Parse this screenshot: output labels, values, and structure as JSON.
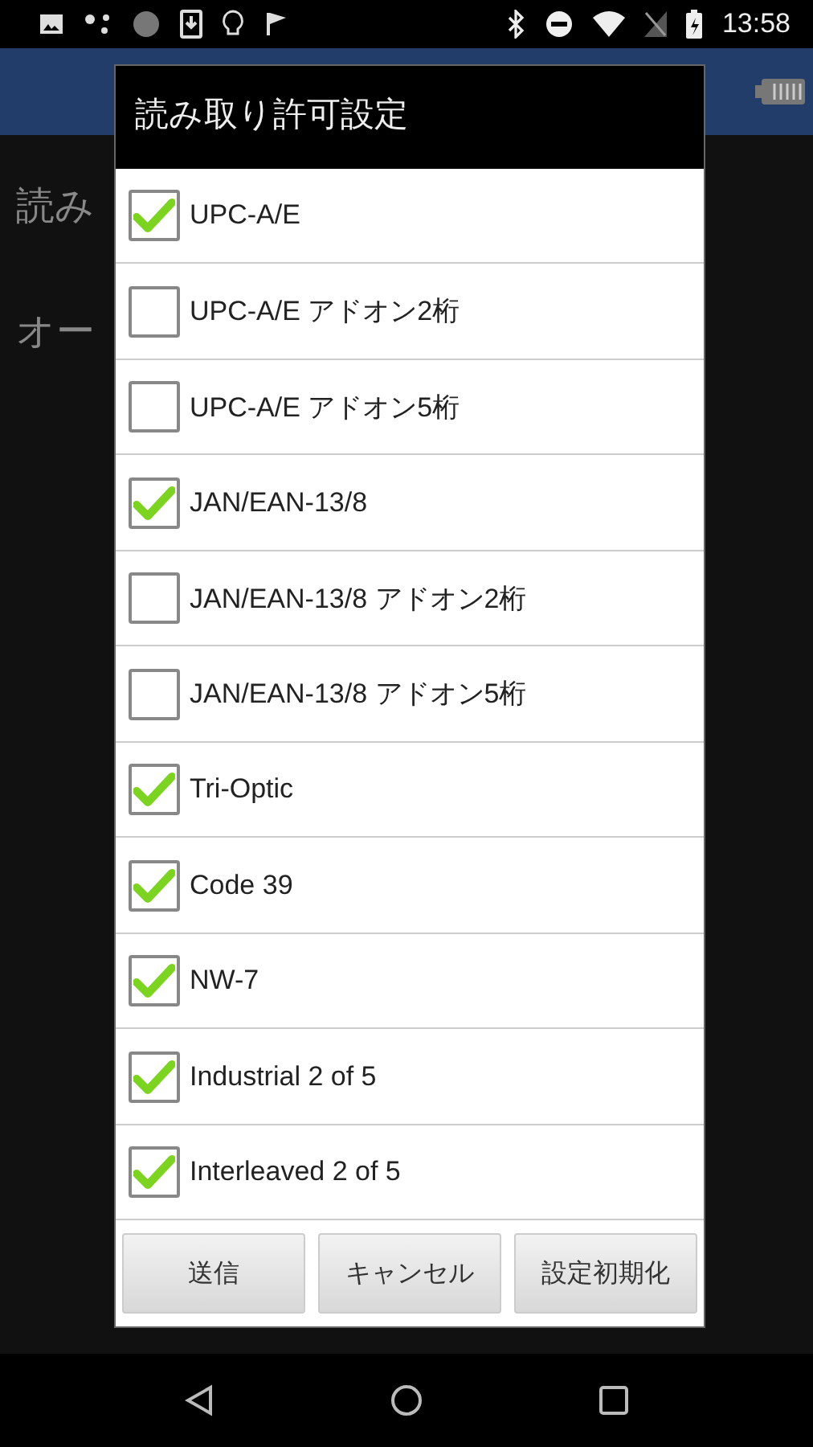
{
  "status_bar": {
    "time": "13:58"
  },
  "background": {
    "texts": [
      "読み",
      "オー"
    ]
  },
  "dialog": {
    "title": "読み取り許可設定",
    "items": [
      {
        "label": "UPC-A/E",
        "checked": true
      },
      {
        "label": "UPC-A/E アドオン2桁",
        "checked": false
      },
      {
        "label": "UPC-A/E アドオン5桁",
        "checked": false
      },
      {
        "label": "JAN/EAN-13/8",
        "checked": true
      },
      {
        "label": "JAN/EAN-13/8 アドオン2桁",
        "checked": false
      },
      {
        "label": "JAN/EAN-13/8 アドオン5桁",
        "checked": false
      },
      {
        "label": "Tri-Optic",
        "checked": true
      },
      {
        "label": "Code 39",
        "checked": true
      },
      {
        "label": "NW-7",
        "checked": true
      },
      {
        "label": "Industrial 2 of 5",
        "checked": true
      },
      {
        "label": "Interleaved 2 of 5",
        "checked": true
      }
    ],
    "buttons": [
      "送信",
      "キャンセル",
      "設定初期化"
    ]
  }
}
